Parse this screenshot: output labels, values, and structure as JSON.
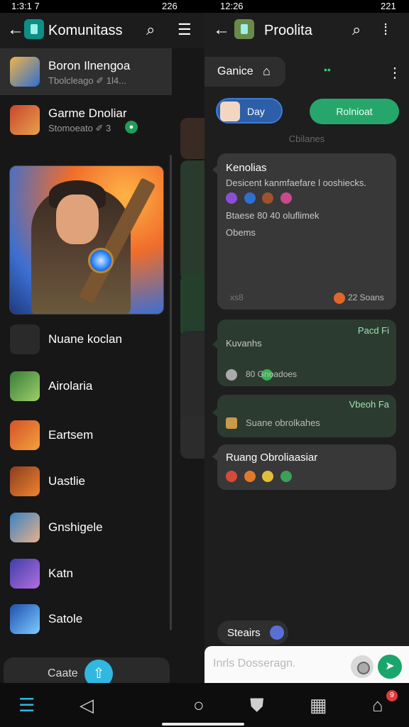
{
  "status": {
    "left_time": "1:3:1 7",
    "left_extra": "226",
    "right_time": "12:26",
    "right_extra": "221"
  },
  "left": {
    "title": "Komunitass",
    "icons": {
      "back": "arrow-left-icon",
      "search": "search-icon",
      "menu": "hamburger-icon"
    },
    "rows": [
      {
        "name": "Boron Ilnengoa",
        "sub": "Tbolcleago  ✐  1l4..."
      },
      {
        "name": "Garme Dnoliar",
        "sub": "Stomoeato  ✐  3"
      }
    ],
    "list": [
      {
        "name": "Nuane koclan",
        "color": "#2a2a2a",
        "accent": "#e04c2c"
      },
      {
        "name": "Airolaria",
        "color": "#3a7d3a",
        "accent": "#9ccf6b"
      },
      {
        "name": "Eartsem",
        "color": "#d6512b",
        "accent": "#f2a13c"
      },
      {
        "name": "Uastlie",
        "color": "#8a3d1f",
        "accent": "#f0842e"
      },
      {
        "name": "Gnshigele",
        "color": "#3b82c4",
        "accent": "#e6b08a"
      },
      {
        "name": "Katn",
        "color": "#3d3fa8",
        "accent": "#b46de0"
      },
      {
        "name": "Satole",
        "color": "#1f4fb0",
        "accent": "#7ecbff"
      }
    ],
    "create_label": "Caate"
  },
  "right": {
    "title": "Proolita",
    "pill_label": "Ganice",
    "day_label": "Day",
    "green_label": "Rolnioat",
    "section_label": "Cbilanes",
    "bubbles": [
      {
        "title": "Kenolias",
        "line1": "Desicent  kanmfaefare l ooshiecks.",
        "line3": "Btaese  80   40  oluflimek",
        "line4": "Obems",
        "meta": "xs8",
        "count": "22  Soans"
      },
      {
        "right": "Pacd Fi",
        "title": "Kuvanhs",
        "meta": "80     Gnoadoes"
      },
      {
        "right": "Vbeoh Fa",
        "meta": "Suane obrolkahes"
      },
      {
        "title": "Ruang Obroliaasiar"
      }
    ],
    "chip_label": "Steairs",
    "composer_placeholder": "Inrls Dosseragn."
  },
  "nav": {
    "badge": "9"
  }
}
